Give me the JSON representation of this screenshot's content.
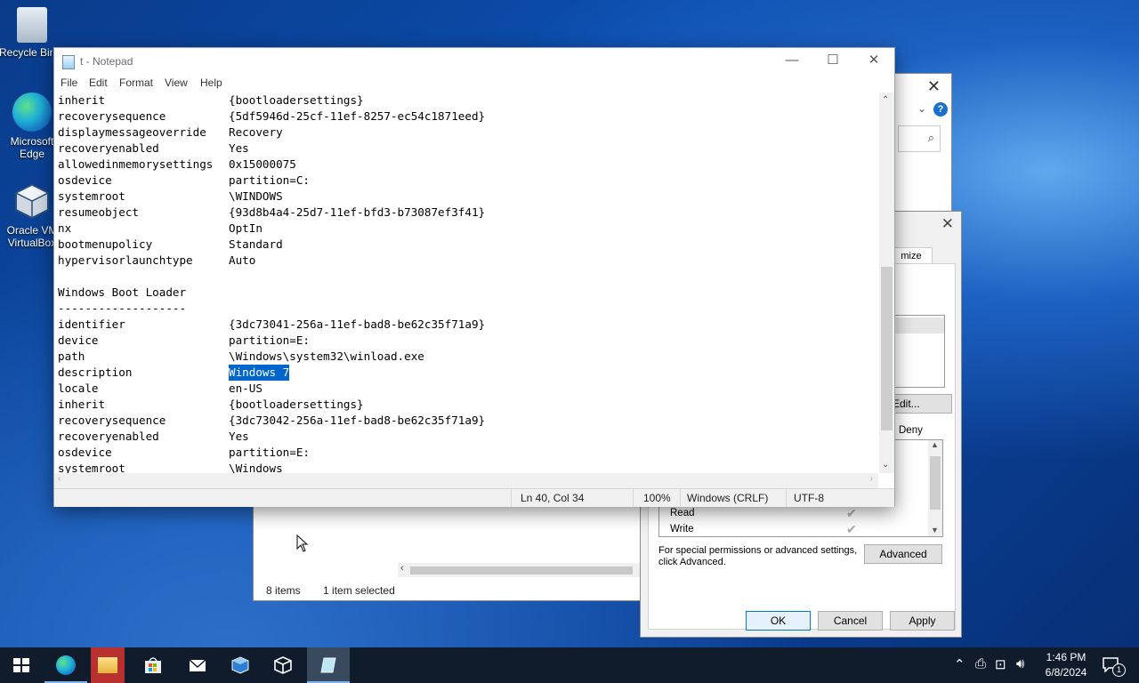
{
  "desktop": {
    "icons": [
      {
        "label": "Recycle Bin"
      },
      {
        "label": "Microsoft Edge"
      },
      {
        "label": "Oracle VM VirtualBox"
      }
    ]
  },
  "explorer": {
    "status_items": "8 items",
    "status_selected": "1 item selected"
  },
  "props": {
    "tab_label": "mize",
    "edit_button": "Edit...",
    "deny_header": "Deny",
    "permissions": [
      {
        "label": "Read"
      },
      {
        "label": "Write"
      }
    ],
    "advanced_text": "For special permissions or advanced settings, click Advanced.",
    "advanced_button": "Advanced",
    "ok_button": "OK",
    "cancel_button": "Cancel",
    "apply_button": "Apply"
  },
  "notepad": {
    "title": "t - Notepad",
    "menu": [
      "File",
      "Edit",
      "Format",
      "View",
      "Help"
    ],
    "lines": [
      {
        "key": "inherit",
        "value": "{bootloadersettings}"
      },
      {
        "key": "recoverysequence",
        "value": "{5df5946d-25cf-11ef-8257-ec54c1871eed}"
      },
      {
        "key": "displaymessageoverride",
        "value": "Recovery"
      },
      {
        "key": "recoveryenabled",
        "value": "Yes"
      },
      {
        "key": "allowedinmemorysettings",
        "value": "0x15000075"
      },
      {
        "key": "osdevice",
        "value": "partition=C:"
      },
      {
        "key": "systemroot",
        "value": "\\WINDOWS"
      },
      {
        "key": "resumeobject",
        "value": "{93d8b4a4-25d7-11ef-bfd3-b73087ef3f41}"
      },
      {
        "key": "nx",
        "value": "OptIn"
      },
      {
        "key": "bootmenupolicy",
        "value": "Standard"
      },
      {
        "key": "hypervisorlaunchtype",
        "value": "Auto"
      },
      {
        "key": "",
        "value": ""
      },
      {
        "key": "Windows Boot Loader",
        "value": ""
      },
      {
        "key": "-------------------",
        "value": ""
      },
      {
        "key": "identifier",
        "value": "{3dc73041-256a-11ef-bad8-be62c35f71a9}"
      },
      {
        "key": "device",
        "value": "partition=E:"
      },
      {
        "key": "path",
        "value": "\\Windows\\system32\\winload.exe"
      },
      {
        "key": "description",
        "value": "Windows 7",
        "selected": true
      },
      {
        "key": "locale",
        "value": "en-US"
      },
      {
        "key": "inherit",
        "value": "{bootloadersettings}"
      },
      {
        "key": "recoverysequence",
        "value": "{3dc73042-256a-11ef-bad8-be62c35f71a9}"
      },
      {
        "key": "recoveryenabled",
        "value": "Yes"
      },
      {
        "key": "osdevice",
        "value": "partition=E:"
      },
      {
        "key": "systemroot",
        "value": "\\Windows"
      }
    ],
    "status": {
      "position": "Ln 40, Col 34",
      "zoom": "100%",
      "line_ending": "Windows (CRLF)",
      "encoding": "UTF-8"
    }
  },
  "taskbar": {
    "apps": [
      {
        "icon": "windows-start-icon"
      },
      {
        "icon": "edge-icon"
      },
      {
        "icon": "file-explorer-icon"
      },
      {
        "icon": "store-icon"
      },
      {
        "icon": "mail-icon"
      },
      {
        "icon": "virtualbox-icon"
      },
      {
        "icon": "cube-icon"
      },
      {
        "icon": "notepad-icon"
      }
    ],
    "time": "1:46 PM",
    "date": "6/8/2024",
    "notification_count": "1"
  }
}
